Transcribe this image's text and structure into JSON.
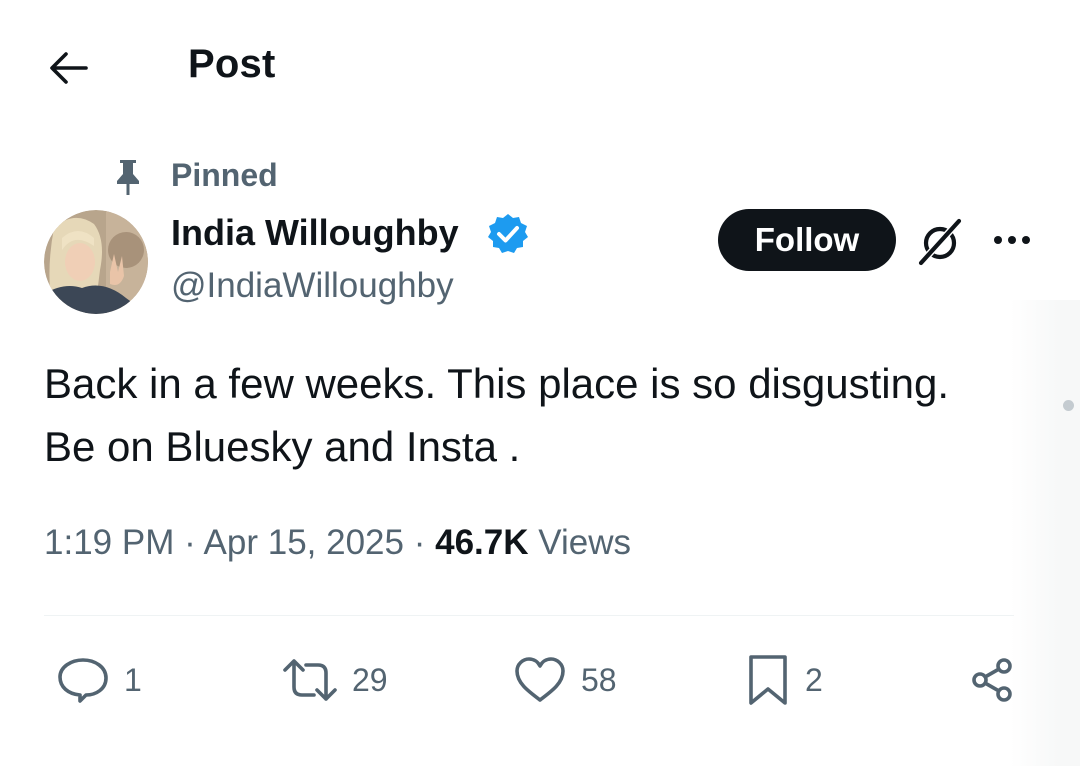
{
  "header": {
    "title": "Post",
    "back_icon": "arrow-left-icon"
  },
  "pinned": {
    "label": "Pinned",
    "icon": "pin-icon"
  },
  "author": {
    "name": "India Willoughby",
    "handle": "@IndiaWilloughby",
    "verified": true,
    "verified_color": "#1d9bf0"
  },
  "actions_top": {
    "follow_label": "Follow",
    "grok_icon": "grok-icon",
    "more_icon": "more-horizontal-icon"
  },
  "post": {
    "line1": "Back in a few weeks. This place is so disgusting.",
    "line2": "Be on Bluesky and Insta ."
  },
  "meta": {
    "time": "1:19 PM",
    "separator": "·",
    "date": "Apr 15, 2025",
    "views_count": "46.7K",
    "views_label": "Views"
  },
  "engagement": {
    "replies": "1",
    "reposts": "29",
    "likes": "58",
    "bookmarks": "2"
  },
  "colors": {
    "text_primary": "#0f1419",
    "text_secondary": "#536471",
    "accent": "#1d9bf0",
    "button_bg": "#0f1419"
  }
}
